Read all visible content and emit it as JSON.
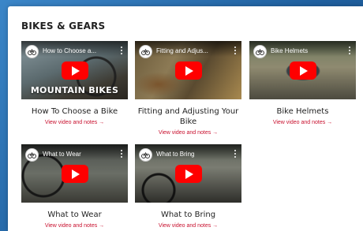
{
  "section": {
    "title": "BIKES & GEARS"
  },
  "colors": {
    "accent": "#c8102e",
    "play": "#ff0000"
  },
  "cards": [
    {
      "video_title": "How to Choose a...",
      "overlay": "MOUNTAIN BIKES",
      "title": "How To Choose a Bike",
      "link": "View video and notes →"
    },
    {
      "video_title": "Fitting and Adjus...",
      "overlay": "",
      "title": "Fitting and Adjusting Your Bike",
      "link": "View video and notes →"
    },
    {
      "video_title": "Bike Helmets",
      "overlay": "",
      "title": "Bike Helmets",
      "link": "View video and notes →"
    },
    {
      "video_title": "What to Wear",
      "overlay": "",
      "title": "What to Wear",
      "link": "View video and notes →"
    },
    {
      "video_title": "What to Bring",
      "overlay": "",
      "title": "What to Bring",
      "link": "View video and notes →"
    }
  ],
  "icons": {
    "channel": "bicycle-logo-icon",
    "more": "more-vertical-icon",
    "play": "youtube-play-icon"
  }
}
